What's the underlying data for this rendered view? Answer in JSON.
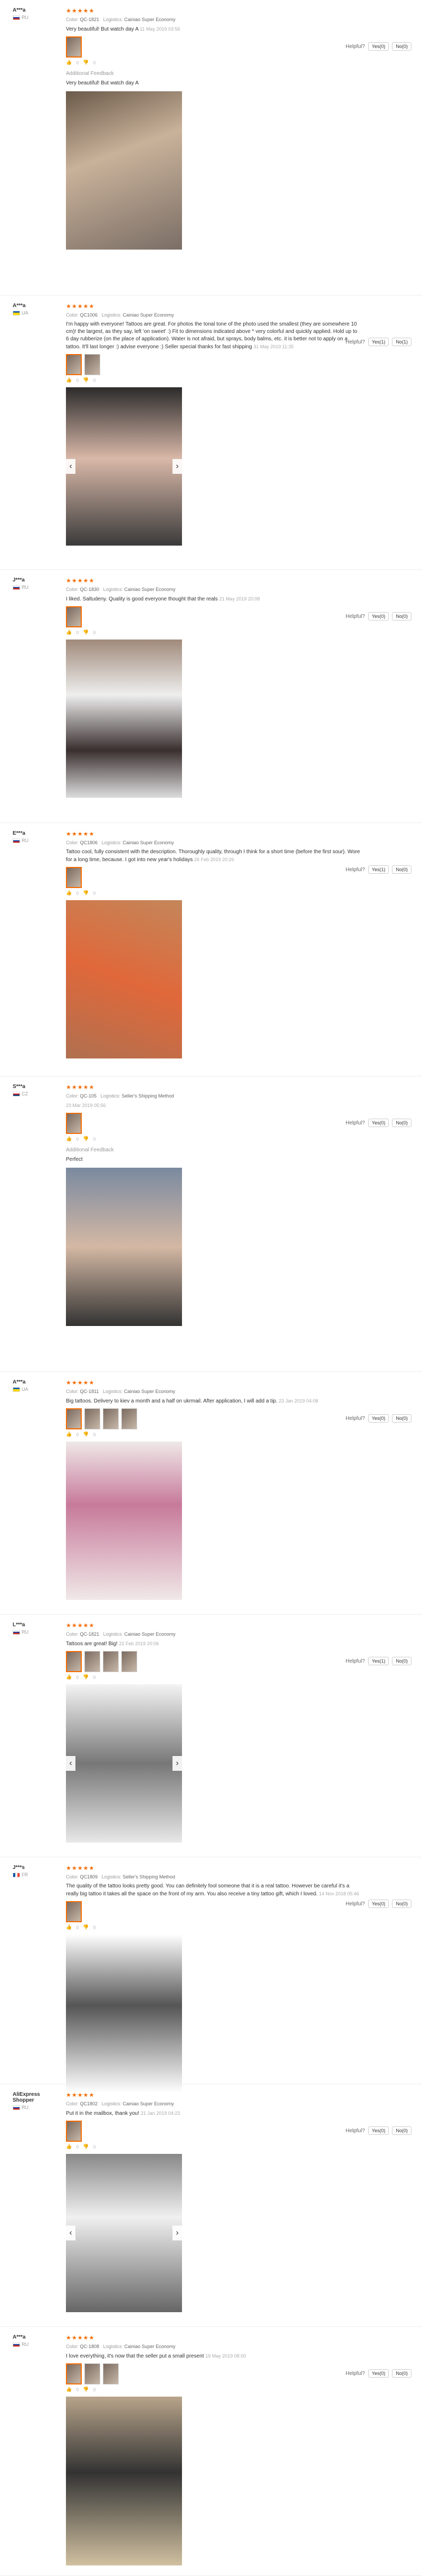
{
  "helpful_label": "Helpful?",
  "yes_prefix": "Yes",
  "no_prefix": "No",
  "additional_feedback_label": "Additional Feedback",
  "color_label": "Color:",
  "logistics_label": "Logistics:",
  "reviews": [
    {
      "user": "A***a",
      "country": "RU",
      "stars": "★★★★★",
      "color": "QC-1821",
      "logistics": "Cainiao Super Economy",
      "text": "Very beautiful! But watch day A",
      "date": "11 May 2019 03:56",
      "yes": "(0)",
      "no": "(0)",
      "additional": "Very beautiful! But watch day A",
      "likes": "0",
      "dislikes": "0"
    },
    {
      "user": "A***a",
      "country": "UA",
      "stars": "★★★★★",
      "color": "QC1006",
      "logistics": "Cainiao Super Economy",
      "text": "I'm happy with everyone! Tattoos are great. For photos the tonal tone of the photo used the smallest (they are somewhere 10 cm)! the largest, as they say, left 'on sweet' :) Fit to dimensions indicated above * very colorful and quickly applied. Hold up to 6 day rubberize (on the place of application). Water is not afraid, but sprays, body balms, etc. it is better not to apply on a tattoo. It'll last longer :) advise everyone :) Seller special thanks for fast shipping",
      "date": "31 May 2019 11:35",
      "yes": "(1)",
      "no": "(1)",
      "likes": "0",
      "dislikes": "0"
    },
    {
      "user": "J***a",
      "country": "RU",
      "stars": "★★★★★",
      "color": "QC-1830",
      "logistics": "Cainiao Super Economy",
      "text": "I liked. Saltudeny. Quality is good everyone thought that the reals",
      "date": "21 May 2019 20:08",
      "yes": "(0)",
      "no": "(0)",
      "likes": "0",
      "dislikes": "0"
    },
    {
      "user": "E***a",
      "country": "RU",
      "stars": "★★★★★",
      "color": "QC1806",
      "logistics": "Cainiao Super Economy",
      "text": "Tattoo cool, fully consistent with the description. Thoroughly quality, through I think for a short time (before the first sour). Wore for a long time, because. I got into new year's holidays",
      "date": "26 Feb 2019 20:26",
      "yes": "(1)",
      "no": "(0)",
      "likes": "0",
      "dislikes": "0"
    },
    {
      "user": "S***a",
      "country": "CZ",
      "stars": "★★★★★",
      "color": "QC-105",
      "logistics": "Seller's Shipping Method",
      "text": "",
      "date": "23 Mar 2019 05:56",
      "yes": "(0)",
      "no": "(0)",
      "additional": "Perfect",
      "likes": "0",
      "dislikes": "0"
    },
    {
      "user": "A***a",
      "country": "UA",
      "stars": "★★★★★",
      "color": "QC-1811",
      "logistics": "Cainiao Super Economy",
      "text": "Big tattoos. Delivery to kiev a month and a half on ukrmail. After application, I will add a tip.",
      "date": "23 Jan 2019 04:08",
      "yes": "(0)",
      "no": "(0)",
      "likes": "0",
      "dislikes": "0"
    },
    {
      "user": "L***a",
      "country": "RU",
      "stars": "★★★★★",
      "color": "QC-1821",
      "logistics": "Cainiao Super Economy",
      "text": "Tattoos are great! Big!",
      "date": "22 Feb 2019 20:06",
      "yes": "(1)",
      "no": "(0)",
      "likes": "0",
      "dislikes": "0"
    },
    {
      "user": "J***s",
      "country": "FR",
      "stars": "★★★★★",
      "color": "QC1809",
      "logistics": "Seller's Shipping Method",
      "text": "The quality of the tattoo looks pretty good. You can definitely fool someone that it is a real tattoo. However be careful it's a really big tattoo it takes all the space on the front of my arm. You also receive a tiny tattoo gift, which I loved.",
      "date": "14 Nov 2018 05:46",
      "yes": "(0)",
      "no": "(0)",
      "likes": "0",
      "dislikes": "0"
    },
    {
      "user": "AliExpress Shopper",
      "country": "RU",
      "stars": "★★★★★",
      "color": "QC1802",
      "logistics": "Cainiao Super Economy",
      "text": "Put it in the mailbox, thank you!",
      "date": "21 Jan 2019 04:23",
      "yes": "(0)",
      "no": "(0)",
      "likes": "0",
      "dislikes": "0"
    },
    {
      "user": "A***a",
      "country": "RU",
      "stars": "★★★★★",
      "color": "QC-1808",
      "logistics": "Cainiao Super Economy",
      "text": "I love everything, it's now that the seller put a small present",
      "date": "19 May 2019 08:00",
      "yes": "(0)",
      "no": "(0)",
      "likes": "0",
      "dislikes": "0"
    }
  ]
}
